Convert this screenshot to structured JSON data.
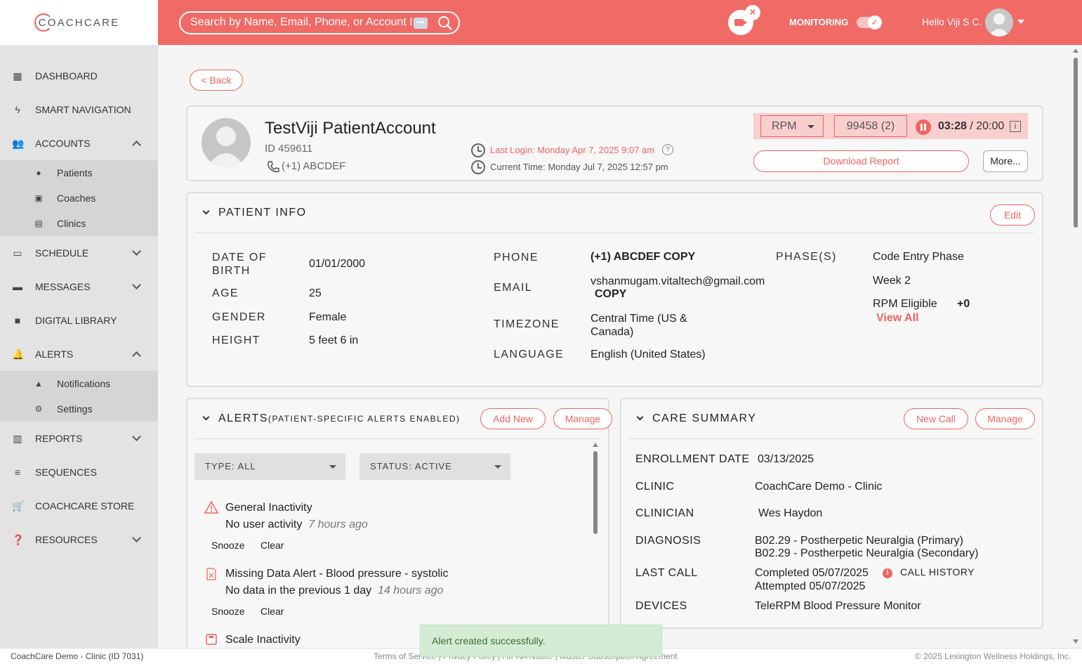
{
  "brand": {
    "logo_text": "COACHCARE"
  },
  "header": {
    "search_placeholder": "Search by Name, Email, Phone, or Account I",
    "search_dots": "•••",
    "monitoring_label": "MONITORING",
    "greeting": "Hello Viji S C.",
    "accent_color": "#f06a66"
  },
  "sidebar": {
    "items": [
      {
        "label": "DASHBOARD",
        "icon": "dashboard-icon"
      },
      {
        "label": "SMART NAVIGATION",
        "icon": "lightning-icon"
      },
      {
        "label": "ACCOUNTS",
        "icon": "people-icon",
        "expanded": true
      },
      {
        "label": "SCHEDULE",
        "icon": "calendar-icon"
      },
      {
        "label": "MESSAGES",
        "icon": "message-icon"
      },
      {
        "label": "DIGITAL LIBRARY",
        "icon": "folder-icon"
      },
      {
        "label": "ALERTS",
        "icon": "bell-icon",
        "expanded": true
      },
      {
        "label": "REPORTS",
        "icon": "report-icon"
      },
      {
        "label": "SEQUENCES",
        "icon": "sequence-icon"
      },
      {
        "label": "COACHCARE STORE",
        "icon": "cart-icon"
      },
      {
        "label": "RESOURCES",
        "icon": "help-icon"
      }
    ],
    "accounts_sub": [
      "Patients",
      "Coaches",
      "Clinics"
    ],
    "alerts_sub": [
      "Notifications",
      "Settings"
    ]
  },
  "patient": {
    "back_label": "< Back",
    "name": "TestViji PatientAccount",
    "id": "ID 459611",
    "phone": "(+1) ABCDEF",
    "last_login": "Last Login: Monday Apr 7, 2025 9:07 am",
    "current_time": "Current Time: Monday Jul 7, 2025 12:57 pm",
    "program": "RPM",
    "code": "99458 (2)",
    "timer_elapsed": "03:28",
    "timer_total": " / 20:00",
    "download_label": "Download Report",
    "more_label": "More..."
  },
  "patient_info": {
    "title": "PATIENT INFO",
    "edit_label": "Edit",
    "dob_label": "DATE OF BIRTH",
    "dob": "01/01/2000",
    "age_label": "AGE",
    "age": "25",
    "gender_label": "GENDER",
    "gender": "Female",
    "height_label": "HEIGHT",
    "height": "5 feet 6 in",
    "phone_label": "PHONE",
    "phone": "(+1) ABCDEF",
    "email_label": "EMAIL",
    "email": "vshanmugam.vitaltech@gmail.com",
    "copy_label": "COPY",
    "timezone_label": "TIMEZONE",
    "timezone": "Central Time (US & Canada)",
    "language_label": "LANGUAGE",
    "language": "English (United States)",
    "phases_label": "PHASE(S)",
    "phases": [
      "Code Entry Phase",
      "Week 2",
      "RPM Eligible"
    ],
    "phase_more": "+0",
    "view_all": "View All"
  },
  "alerts": {
    "title": "ALERTS",
    "subtitle": "(PATIENT-SPECIFIC ALERTS ENABLED)",
    "add_label": "Add New",
    "manage_label": "Manage",
    "type_filter": "TYPE: ALL",
    "status_filter": "STATUS: ACTIVE",
    "snooze_label": "Snooze",
    "clear_label": "Clear",
    "items": [
      {
        "title": "General Inactivity",
        "detail": "No user activity",
        "time": "7 hours ago"
      },
      {
        "title": "Missing Data Alert - Blood pressure - systolic",
        "detail": "No data in the previous 1 day",
        "time": "14 hours ago"
      },
      {
        "title": "Scale Inactivity"
      }
    ]
  },
  "care_summary": {
    "title": "CARE SUMMARY",
    "new_call_label": "New Call",
    "manage_label": "Manage",
    "enrollment_label": "ENROLLMENT DATE",
    "enrollment": "03/13/2025",
    "clinic_label": "CLINIC",
    "clinic": "CoachCare Demo - Clinic",
    "clinician_label": "CLINICIAN",
    "clinician": "Wes Haydon",
    "diagnosis_label": "DIAGNOSIS",
    "diagnosis": [
      "B02.29 - Postherpetic Neuralgia (Primary)",
      "B02.29 - Postherpetic Neuralgia (Secondary)"
    ],
    "last_call_label": "LAST CALL",
    "last_call_completed": "Completed 05/07/2025",
    "last_call_attempted": "Attempted 05/07/2025",
    "call_history": "CALL HISTORY",
    "devices_label": "DEVICES",
    "devices": "TeleRPM Blood Pressure Monitor"
  },
  "toast": {
    "message": "Alert created successfully."
  },
  "footer": {
    "clinic": "CoachCare Demo - Clinic (ID 7031)",
    "links": "Terms of Service  |  Privacy Policy  |  HIPAA Notice  |  Master Subscription Agreement",
    "copyright": "© 2025 Lexington Wellness Holdings, Inc."
  }
}
